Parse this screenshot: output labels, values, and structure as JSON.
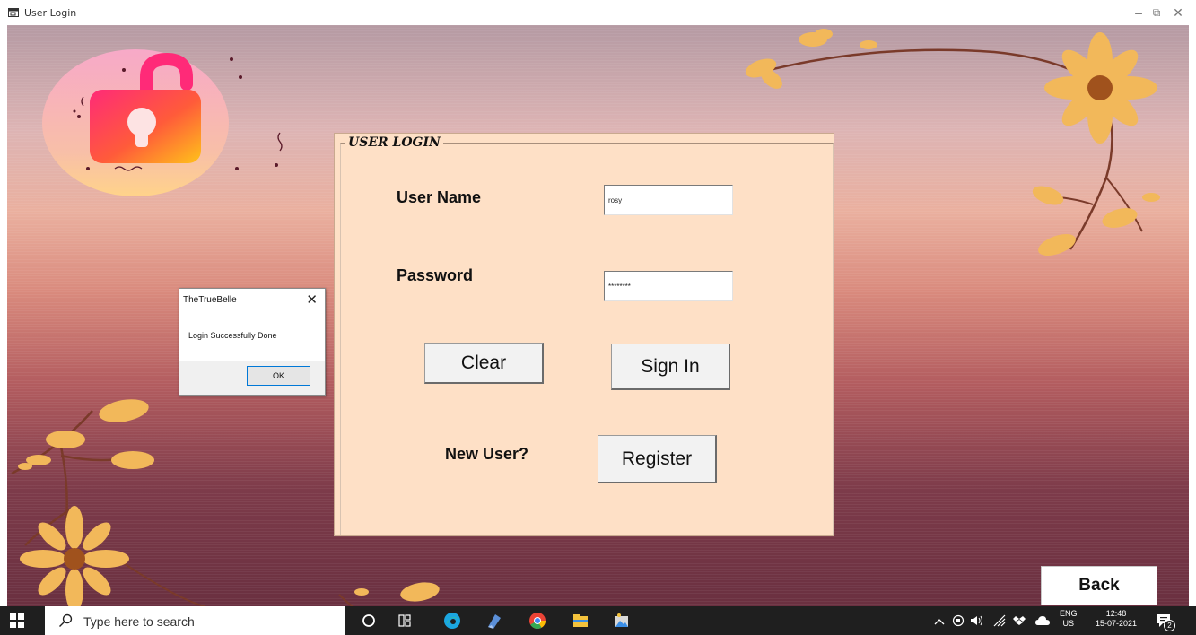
{
  "window": {
    "title": "User Login",
    "minimize_glyph": "–",
    "restore_glyph": "⧉",
    "close_glyph": "✕"
  },
  "login": {
    "legend": "USER LOGIN",
    "username_label": "User Name",
    "username_value": "rosy",
    "password_label": "Password",
    "password_value": "********",
    "clear_label": "Clear",
    "signin_label": "Sign In",
    "new_user_label": "New User?",
    "register_label": "Register"
  },
  "back_label": "Back",
  "messagebox": {
    "title": "TheTrueBelle",
    "message": "Login Successfully Done",
    "ok_label": "OK",
    "close_glyph": "✕"
  },
  "taskbar": {
    "search_placeholder": "Type here to search",
    "lang_line1": "ENG",
    "lang_line2": "US",
    "time": "12:48",
    "date": "15-07-2021",
    "notification_count": "2",
    "icons": [
      "windows-start-icon",
      "search-icon",
      "cortana-icon",
      "task-view-icon",
      "edge-icon",
      "app-icon",
      "chrome-icon",
      "file-explorer-icon",
      "photos-icon"
    ]
  },
  "colors": {
    "panel_bg": "#fee0c6",
    "taskbar_bg": "#1f1f1f",
    "lock_pink": "#ff2f6d",
    "lock_orange": "#ffae1a",
    "flower_yellow": "#f2b85a"
  }
}
